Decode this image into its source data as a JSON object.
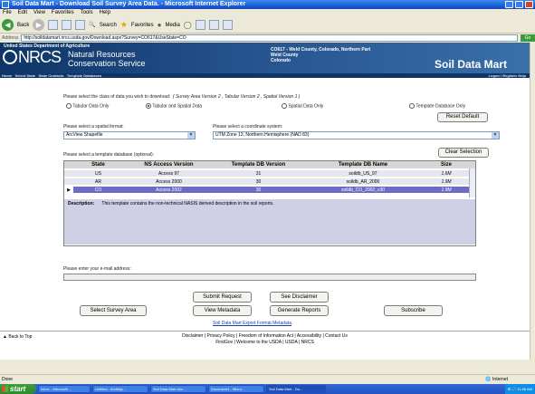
{
  "window": {
    "title": "Soil Data Mart - Download Soil Survey Area Data. - Microsoft Internet Explorer"
  },
  "menu": [
    "File",
    "Edit",
    "View",
    "Favorites",
    "Tools",
    "Help"
  ],
  "toolbar": {
    "back_label": "Back",
    "search_label": "Search",
    "favorites_label": "Favorites",
    "media_label": "Media"
  },
  "address": {
    "label": "Address",
    "url": "http://soildatamart.nrcs.usda.gov/Download.aspx?Survey=CO617&UseState=CO",
    "go_label": "Go"
  },
  "banner": {
    "agency": "United States Department of Agriculture",
    "logo_letters": "NRCS",
    "org_line1": "Natural Resources",
    "org_line2": "Conservation Service",
    "survey_line1": "CO617 - Weld County, Colorado, Northern Part",
    "survey_line2": "Weld County",
    "survey_line3": "Colorado",
    "brand": "Soil Data Mart",
    "login_links": "Logon / Register   Help"
  },
  "nav": [
    "Home",
    "Select State",
    "State Contacts",
    "Template Databases"
  ],
  "download": {
    "class_prompt": "Please select the class of data you wish to download:",
    "class_versions": "( Survey Area Version 2 , Tabular Version 2 , Spatial Version 1 )",
    "options": [
      {
        "label": "Tabular Data Only",
        "selected": false
      },
      {
        "label": "Tabular and Spatial Data",
        "selected": true
      },
      {
        "label": "Spatial Data Only",
        "selected": false
      },
      {
        "label": "Template Database Only",
        "selected": false
      }
    ],
    "reset_label": "Reset Default",
    "spatial_format_label": "Please select a spatial format:",
    "spatial_format_value": "ArcView Shapefile",
    "coord_label": "Please select a coordinate system:",
    "coord_value": "UTM Zone 13, Northern Hemisphere (NAD 83)",
    "template_label": "Please select a template database (optional):",
    "clear_selection_label": "Clear Selection"
  },
  "grid": {
    "headers": [
      "State",
      "NS Access Version",
      "Template DB Version",
      "Template DB Name",
      "Size"
    ],
    "rows": [
      {
        "state": "US",
        "access": "Access 97",
        "version": "31",
        "name": "soildb_US_97",
        "size": "1.6M",
        "selected": false
      },
      {
        "state": "AR",
        "access": "Access 2000",
        "version": "30",
        "name": "soildb_AR_2000",
        "size": "1.9M",
        "selected": false
      },
      {
        "state": "CO",
        "access": "Access 2002",
        "version": "30",
        "name": "soildb_CO_2002_v30",
        "size": "1.9M",
        "selected": true
      }
    ],
    "description_label": "Description:",
    "description_text": "This template contains the non-technical NASIS derived description in the soil reports."
  },
  "email": {
    "label": "Please enter your e-mail address:"
  },
  "buttons": {
    "submit": "Submit Request",
    "disclaimer": "See Disclaimer",
    "select_survey": "Select Survey Area",
    "view_metadata": "View Metadata",
    "generate_reports": "Generate Reports",
    "subscribe": "Subscribe"
  },
  "metadata_link": "Soil Data Mart Export Format Metadata",
  "footer": {
    "back_to_top": "Back to Top",
    "line1": "Disclaimer | Privacy Policy | Freedom of Information Act | Accessibility | Contact Us",
    "line2": "FirstGov | Welcome to the USDA | USDA | NRCS"
  },
  "status": {
    "left": "Done",
    "zone": "Internet"
  },
  "taskbar": {
    "start": "start",
    "tasks": [
      "Inbox - Microsoft ...",
      "Untitled - ArcMap ...",
      "Soil Data Mart.doc ...",
      "Document1 - Micro...",
      "Soil Data Mart - Do..."
    ],
    "clock": "11:58 AM"
  }
}
